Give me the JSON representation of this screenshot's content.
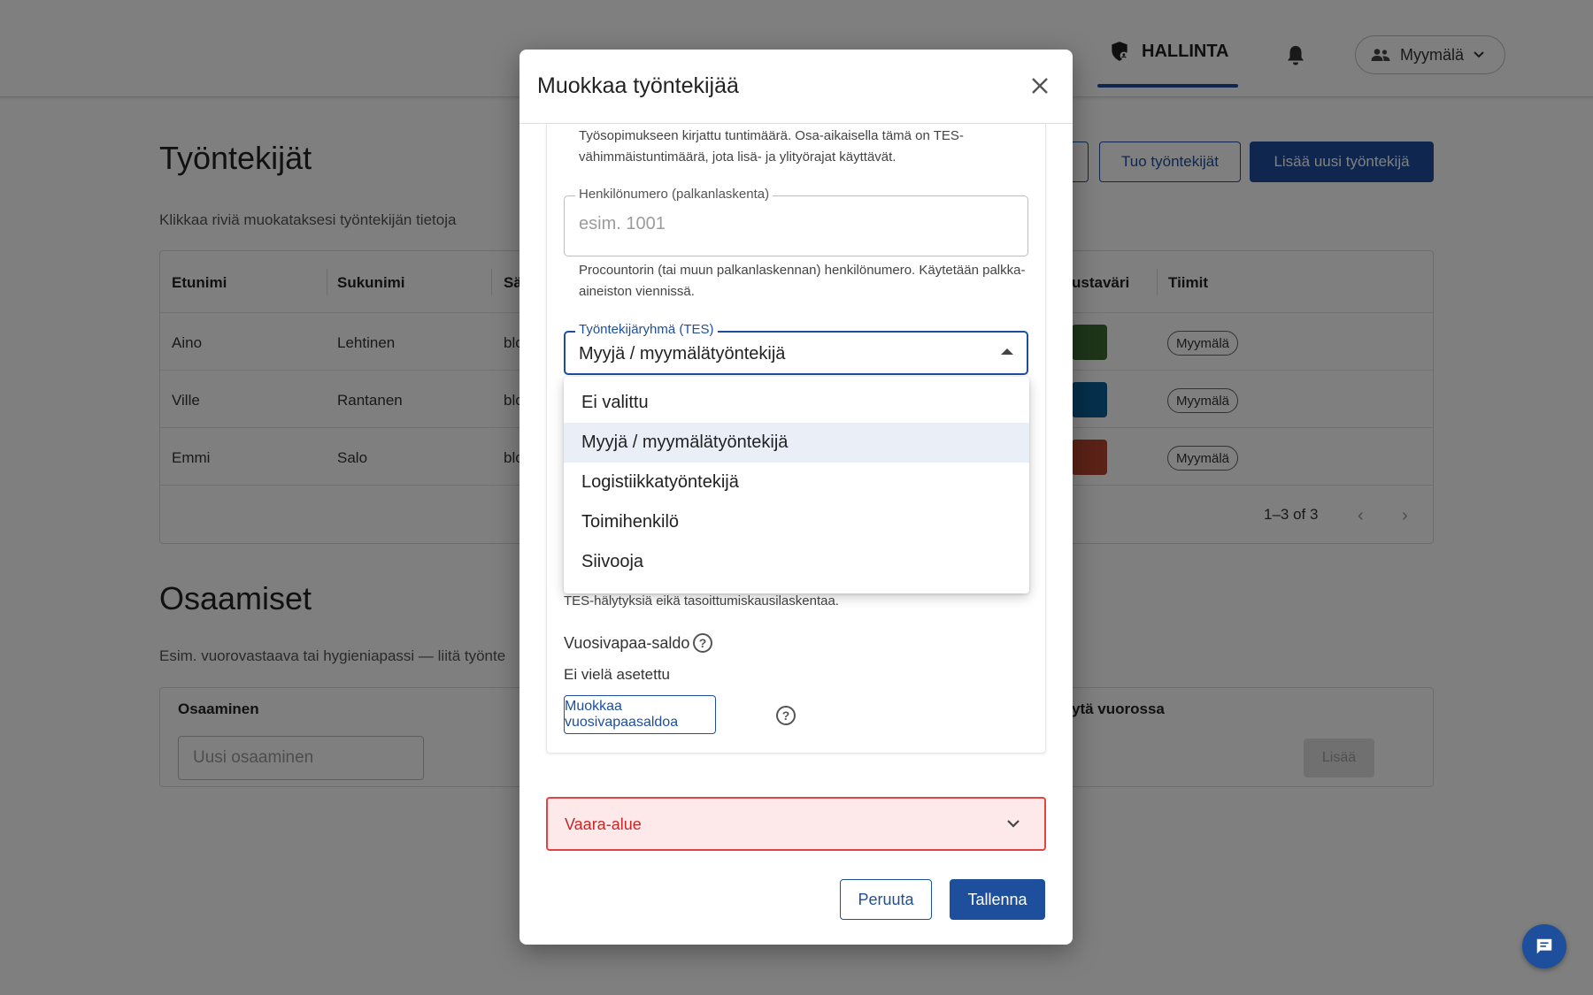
{
  "topbar": {
    "nav_active_label": "HALLINTA",
    "team_select_value": "Myymälä"
  },
  "employees": {
    "title": "Työntekijät",
    "subtitle": "Klikkaa riviä muokataksesi työntekijän tietoja",
    "import_button": "Tuo työntekijät",
    "add_button": "Lisää uusi työntekijä",
    "columns": [
      "Etunimi",
      "Sukunimi",
      "Sä",
      "ustaväri",
      "Tiimit"
    ],
    "rows": [
      {
        "first": "Aino",
        "last": "Lehtinen",
        "email": "blo",
        "color": "#3c6b35",
        "team": "Myymälä"
      },
      {
        "first": "Ville",
        "last": "Rantanen",
        "email": "blo",
        "color": "#0b5f96",
        "team": "Myymälä"
      },
      {
        "first": "Emmi",
        "last": "Salo",
        "email": "blo",
        "color": "#b7442e",
        "team": "Myymälä"
      }
    ],
    "pagination": "1–3 of 3"
  },
  "skills": {
    "title": "Osaamiset",
    "subtitle": "Esim. vuorovastaava tai hygieniapassi — liitä työnte",
    "col_skill": "Osaaminen",
    "col_shift": "ytä vuorossa",
    "input_placeholder": "Uusi osaaminen",
    "add_button": "Lisää"
  },
  "modal": {
    "title": "Muokkaa työntekijää",
    "hours_helper": "Työsopimukseen kirjattu tuntimäärä. Osa-aikaisella tämä on TES-vähimmäistuntimäärä, jota lisä- ja ylityörajat käyttävät.",
    "personnel_number": {
      "label": "Henkilönumero (palkanlaskenta)",
      "placeholder": "esim. 1001",
      "helper": "Procountorin (tai muun palkanlaskennan) henkilönumero. Käytetään palkka-aineiston viennissä."
    },
    "employee_group": {
      "label": "Työntekijäryhmä (TES)",
      "value": "Myyjä / myymälätyöntekijä",
      "options": [
        "Ei valittu",
        "Myyjä / myymälätyöntekijä",
        "Logistiikkatyöntekijä",
        "Toimihenkilö",
        "Siivooja"
      ],
      "selected_index": 1
    },
    "group_helper_tail": "TES-hälytyksiä eikä tasoittumiskausilaskentaa.",
    "vacation": {
      "label": "Vuosivapaa-saldo",
      "status": "Ei vielä asetettu",
      "edit_button": "Muokkaa vuosivapaasaldoa"
    },
    "danger_zone": "Vaara-alue",
    "cancel_button": "Peruuta",
    "save_button": "Tallenna"
  },
  "colors": {
    "primary": "#1e4f9c",
    "danger": "#c62828"
  }
}
